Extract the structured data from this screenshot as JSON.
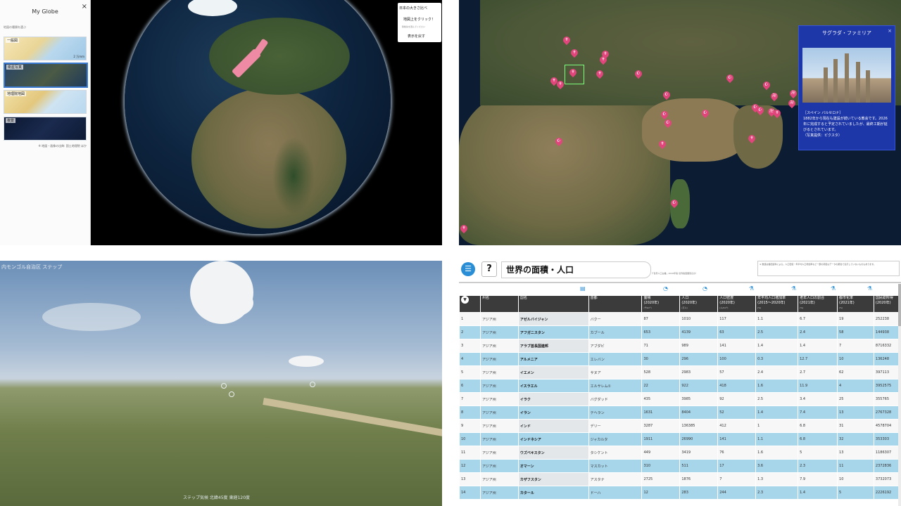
{
  "colors": {
    "accent": "#2a8ed6",
    "pin": "#e0457b",
    "info_bg": "#1d36a8",
    "table_header": "#3b3b3b",
    "row_highlight": "#a7d5ea"
  },
  "myglobe": {
    "title": "My Globe",
    "close": "×",
    "hint": "地図の種類を選ぶ",
    "maps": [
      {
        "label": "一般図",
        "sub": "2 万mm"
      },
      {
        "label": "衛星写真",
        "sub": ""
      },
      {
        "label": "地理院地図",
        "sub": ""
      },
      {
        "label": "夜景",
        "sub": ""
      }
    ],
    "note": "※ 地図・画像の出典: 国土地理院 ほか",
    "popup": {
      "line1": "日本の大きさ比べ",
      "line2": "地図上をクリック！",
      "line3": "移動先を選んでください",
      "button": "表示を戻す"
    }
  },
  "worldmap": {
    "info_title": "サグラダ・ファミリア",
    "info_close": "×",
    "info_desc": "［スペイン バルセロナ］\n1882年から現在も建設が続いている教会です。2026年に完成すると予定されていましたが、最終工期が延びるとされています。\n（写真提供：ピクスタ）",
    "pins": [
      "✝",
      "✝",
      "✝",
      "✝",
      "✝",
      "✝",
      "☪",
      "☪",
      "☪",
      "☪",
      "卍",
      "卍",
      "卍",
      "☪",
      "☪",
      "✝",
      "✝",
      "☪",
      "☪",
      "☪",
      "✝",
      "卍",
      "✝",
      "☪",
      "✝",
      "☪",
      "✝"
    ]
  },
  "streetview": {
    "tag": "内モンゴル自治区 ステップ",
    "footer": "ステップ気候 北緯45度 東経120度"
  },
  "table": {
    "title": "世界の面積・人口",
    "source": "（「世界人口白書」2020年版 世界各国要覧ほか）",
    "note": "※ 数値は各国資料による。人口密度・年平均人口増加率など一部の項目はデータの都合で表示していないものもあります。",
    "sort_icon": "▼",
    "menu_icon": "☰",
    "help": "?",
    "headers": [
      {
        "label": "州名",
        "unit": ""
      },
      {
        "label": "国名",
        "unit": ""
      },
      {
        "label": "首都",
        "unit": ""
      },
      {
        "label": "面積\n(2020年)",
        "unit": "(千km²)"
      },
      {
        "label": "人口\n(2020年)",
        "unit": "(万人)"
      },
      {
        "label": "人口密度\n(2020年)",
        "unit": "(人/km²)"
      },
      {
        "label": "年平均人口増加率\n(2015〜2020年)",
        "unit": "(%)"
      },
      {
        "label": "老年人口の割合\n(2021年)",
        "unit": "(%)"
      },
      {
        "label": "都市化率\n(2021年)",
        "unit": "(%)"
      },
      {
        "label": "国民総所得\n(2020年)",
        "unit": ""
      }
    ],
    "rows": [
      [
        "1",
        "アジア州",
        "アゼルバイジャン",
        "バクー",
        "87",
        "1010",
        "117",
        "1.1",
        "6.7",
        "19",
        "252238"
      ],
      [
        "2",
        "アジア州",
        "アフガニスタン",
        "カブール",
        "653",
        "4139",
        "63",
        "2.5",
        "2.4",
        "58",
        "144938"
      ],
      [
        "3",
        "アジア州",
        "アラブ首長国連邦",
        "アブダビ",
        "71",
        "989",
        "141",
        "1.4",
        "1.4",
        "7",
        "8716332"
      ],
      [
        "4",
        "アジア州",
        "アルメニア",
        "エレバン",
        "30",
        "296",
        "100",
        "0.3",
        "12.7",
        "10",
        "136248"
      ],
      [
        "5",
        "アジア州",
        "イエメン",
        "サヌア",
        "528",
        "2983",
        "57",
        "2.4",
        "2.7",
        "62",
        "397113"
      ],
      [
        "6",
        "アジア州",
        "イスラエル",
        "エルサレム①",
        "22",
        "922",
        "418",
        "1.6",
        "11.9",
        "4",
        "3952575"
      ],
      [
        "7",
        "アジア州",
        "イラク",
        "バグダッド",
        "435",
        "3985",
        "92",
        "2.5",
        "3.4",
        "25",
        "355765"
      ],
      [
        "8",
        "アジア州",
        "イラン",
        "テヘラン",
        "1631",
        "8404",
        "52",
        "1.4",
        "7.4",
        "13",
        "2767328"
      ],
      [
        "9",
        "アジア州",
        "インド",
        "デリー",
        "3287",
        "136385",
        "412",
        "1",
        "6.8",
        "31",
        "4578704"
      ],
      [
        "10",
        "アジア州",
        "インドネシア",
        "ジャカルタ",
        "1911",
        "26990",
        "141",
        "1.1",
        "6.8",
        "32",
        "353303"
      ],
      [
        "11",
        "アジア州",
        "ウズベキスタン",
        "タシケント",
        "449",
        "3419",
        "76",
        "1.6",
        "5",
        "13",
        "1186307"
      ],
      [
        "12",
        "アジア州",
        "オマーン",
        "マスカット",
        "310",
        "511",
        "17",
        "3.6",
        "2.3",
        "11",
        "2372836"
      ],
      [
        "13",
        "アジア州",
        "カザフスタン",
        "アスタナ",
        "2725",
        "1876",
        "7",
        "1.3",
        "7.9",
        "10",
        "3732073"
      ],
      [
        "14",
        "アジア州",
        "カタール",
        "ドーハ",
        "12",
        "283",
        "244",
        "2.3",
        "1.4",
        "5",
        "2226192"
      ]
    ]
  }
}
